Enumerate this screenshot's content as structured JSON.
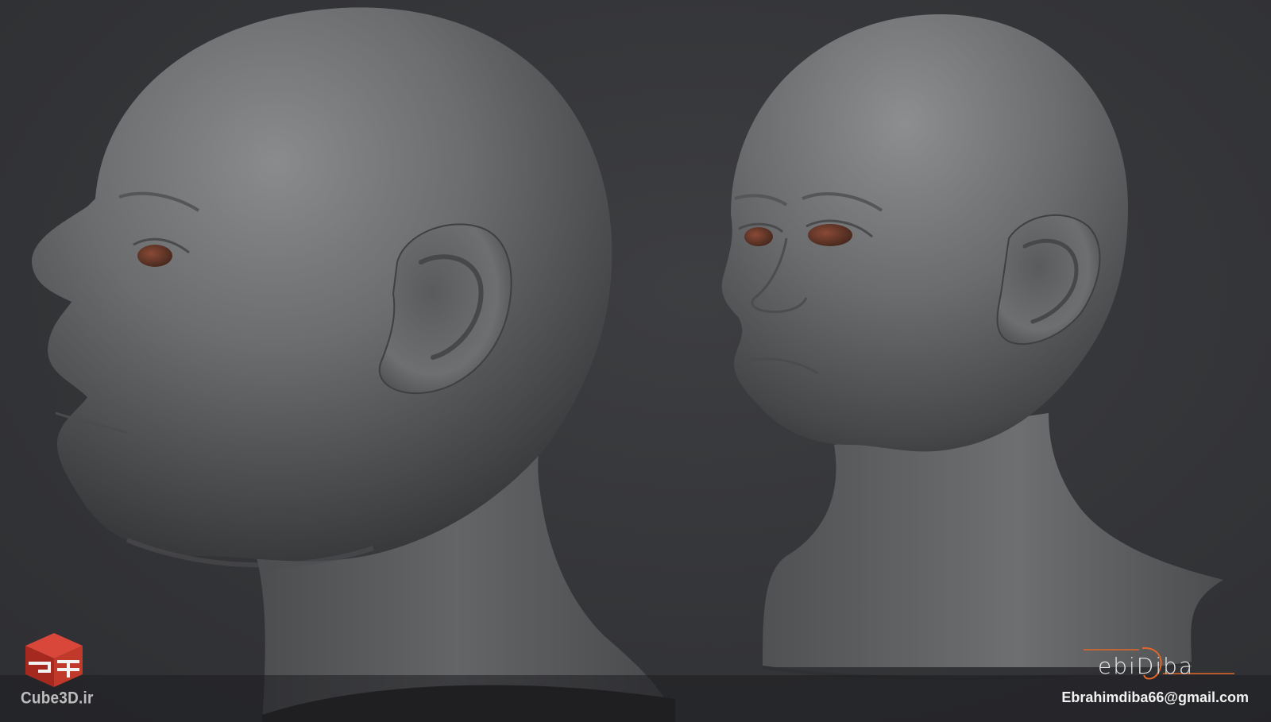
{
  "scene": {
    "subject_left": "head-profile-view",
    "subject_right": "head-three-quarter-view",
    "background_color": "#343538",
    "clay_color": "#6a6b6d",
    "eye_color": "#6b3b2c",
    "accent_color": "#e0662a"
  },
  "watermark_left": {
    "site": "Cube3D.ir",
    "logo_icon": "cube-logo-icon",
    "logo_color": "#c0392b"
  },
  "watermark_right": {
    "brand": "ebiDiba",
    "email": "Ebrahimdiba66@gmail.com"
  }
}
